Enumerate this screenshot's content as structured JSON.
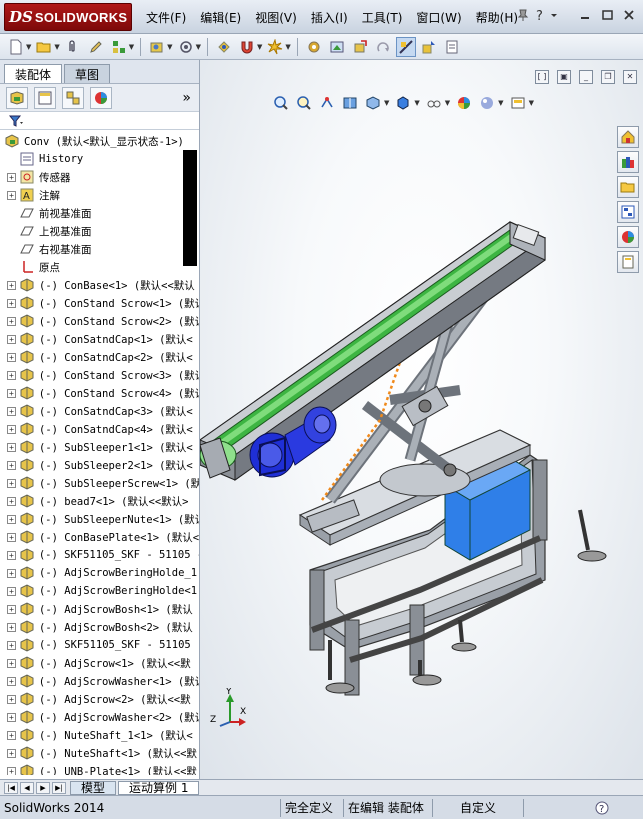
{
  "app": {
    "brand_ds": "DS",
    "brand_name": "SOLIDWORKS"
  },
  "menu": [
    "文件(F)",
    "编辑(E)",
    "视图(V)",
    "插入(I)",
    "工具(T)",
    "窗口(W)",
    "帮助(H)"
  ],
  "panel_tabs": [
    "装配体",
    "草图"
  ],
  "tree": {
    "root": "Conv  (默认<默认_显示状态-1>)",
    "features": [
      {
        "label": "History",
        "icon": "history-icon"
      },
      {
        "label": "传感器",
        "icon": "sensor-icon"
      },
      {
        "label": "注解",
        "icon": "annotation-icon"
      },
      {
        "label": "前视基准面",
        "icon": "plane-icon"
      },
      {
        "label": "上视基准面",
        "icon": "plane-icon"
      },
      {
        "label": "右视基准面",
        "icon": "plane-icon"
      },
      {
        "label": "原点",
        "icon": "origin-icon"
      }
    ],
    "components": [
      "(-) ConBase<1> (默认<<默认",
      "(-) ConStand Scrow<1> (默认",
      "(-) ConStand Scrow<2> (默认",
      "(-) ConSatndCap<1> (默认<",
      "(-) ConSatndCap<2> (默认<",
      "(-) ConStand Scrow<3> (默认",
      "(-) ConStand Scrow<4> (默认",
      "(-) ConSatndCap<3> (默认<",
      "(-) ConSatndCap<4> (默认<",
      "(-) SubSleeper1<1> (默认<",
      "(-) SubSleeper2<1> (默认<",
      "(-) SubSleeperScrew<1> (默",
      "(-) bead7<1> (默认<<默认>",
      "(-) SubSleeperNute<1> (默认",
      "(-) ConBasePlate<1> (默认<",
      "(-) SKF51105_SKF - 51105 -",
      "(-) AdjScrowBeringHolde_1",
      "(-) AdjScrowBeringHolde<1",
      "(-) AdjScrowBosh<1> (默认",
      "(-) AdjScrowBosh<2> (默认",
      "(-) SKF51105_SKF - 51105",
      "(-) AdjScrow<1> (默认<<默",
      "(-) AdjScrowWasher<1> (默认",
      "(-) AdjScrow<2> (默认<<默",
      "(-) AdjScrowWasher<2> (默认",
      "(-) NuteShaft_1<1> (默认<",
      "(-) NuteShaft<1> (默认<<默",
      "(-) UNB-Plate<1> (默认<<默"
    ]
  },
  "bottom_tabs": [
    "模型",
    "运动算例 1"
  ],
  "status": {
    "app_version": "SolidWorks 2014",
    "state": "完全定义",
    "mode": "在编辑 装配体",
    "custom": "自定义"
  },
  "triad": {
    "x": "X",
    "y": "Y",
    "z": "Z"
  },
  "colors": {
    "brand_red": "#a11313",
    "frame_gray": "#8a8f96",
    "belt_green": "#3db542",
    "motor_blue": "#1f2fd6",
    "box_blue": "#2f7fe8",
    "path_orange": "#f08a1c"
  }
}
